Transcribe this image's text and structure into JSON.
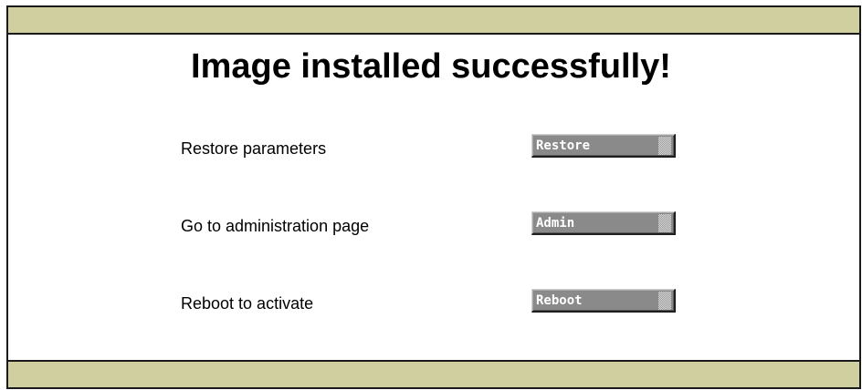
{
  "page": {
    "title": "Image installed successfully!"
  },
  "actions": [
    {
      "label": "Restore parameters",
      "button": "Restore"
    },
    {
      "label": "Go to administration page",
      "button": "Admin"
    },
    {
      "label": "Reboot to activate",
      "button": "Reboot"
    }
  ],
  "colors": {
    "bar": "#cfcf9f",
    "button": "#8a8a8a",
    "border": "#1a1a1a"
  }
}
